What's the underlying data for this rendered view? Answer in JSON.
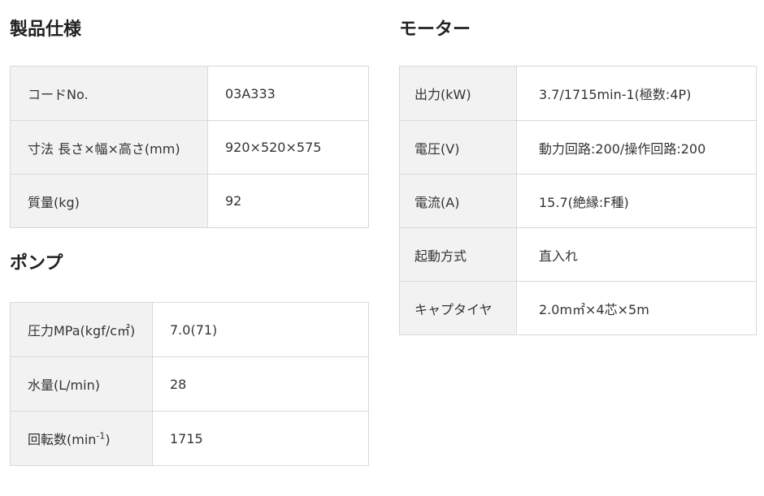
{
  "product": {
    "title": "製品仕様",
    "rows": [
      {
        "label": "コードNo.",
        "value": "03A333"
      },
      {
        "label": "寸法 長さ×幅×高さ(mm)",
        "value": "920×520×575"
      },
      {
        "label": "質量(kg)",
        "value": "92"
      }
    ]
  },
  "pump": {
    "title": "ポンプ",
    "rows": [
      {
        "label": "圧力MPa(kgf/c㎡)",
        "value": "7.0(71)"
      },
      {
        "label": "水量(L/min)",
        "value": "28"
      },
      {
        "label_prefix": "回転数(min",
        "label_sup": "-1",
        "label_suffix": ")",
        "value": "1715"
      }
    ]
  },
  "motor": {
    "title": "モーター",
    "rows": [
      {
        "label": "出力(kW)",
        "value": "3.7/1715min-1(極数:4P)"
      },
      {
        "label": "電圧(V)",
        "value": "動力回路:200/操作回路:200"
      },
      {
        "label": "電流(A)",
        "value": "15.7(絶縁:F種)"
      },
      {
        "label": "起動方式",
        "value": "直入れ"
      },
      {
        "label": "キャプタイヤ",
        "value": "2.0m㎡×4芯×5m"
      }
    ]
  }
}
